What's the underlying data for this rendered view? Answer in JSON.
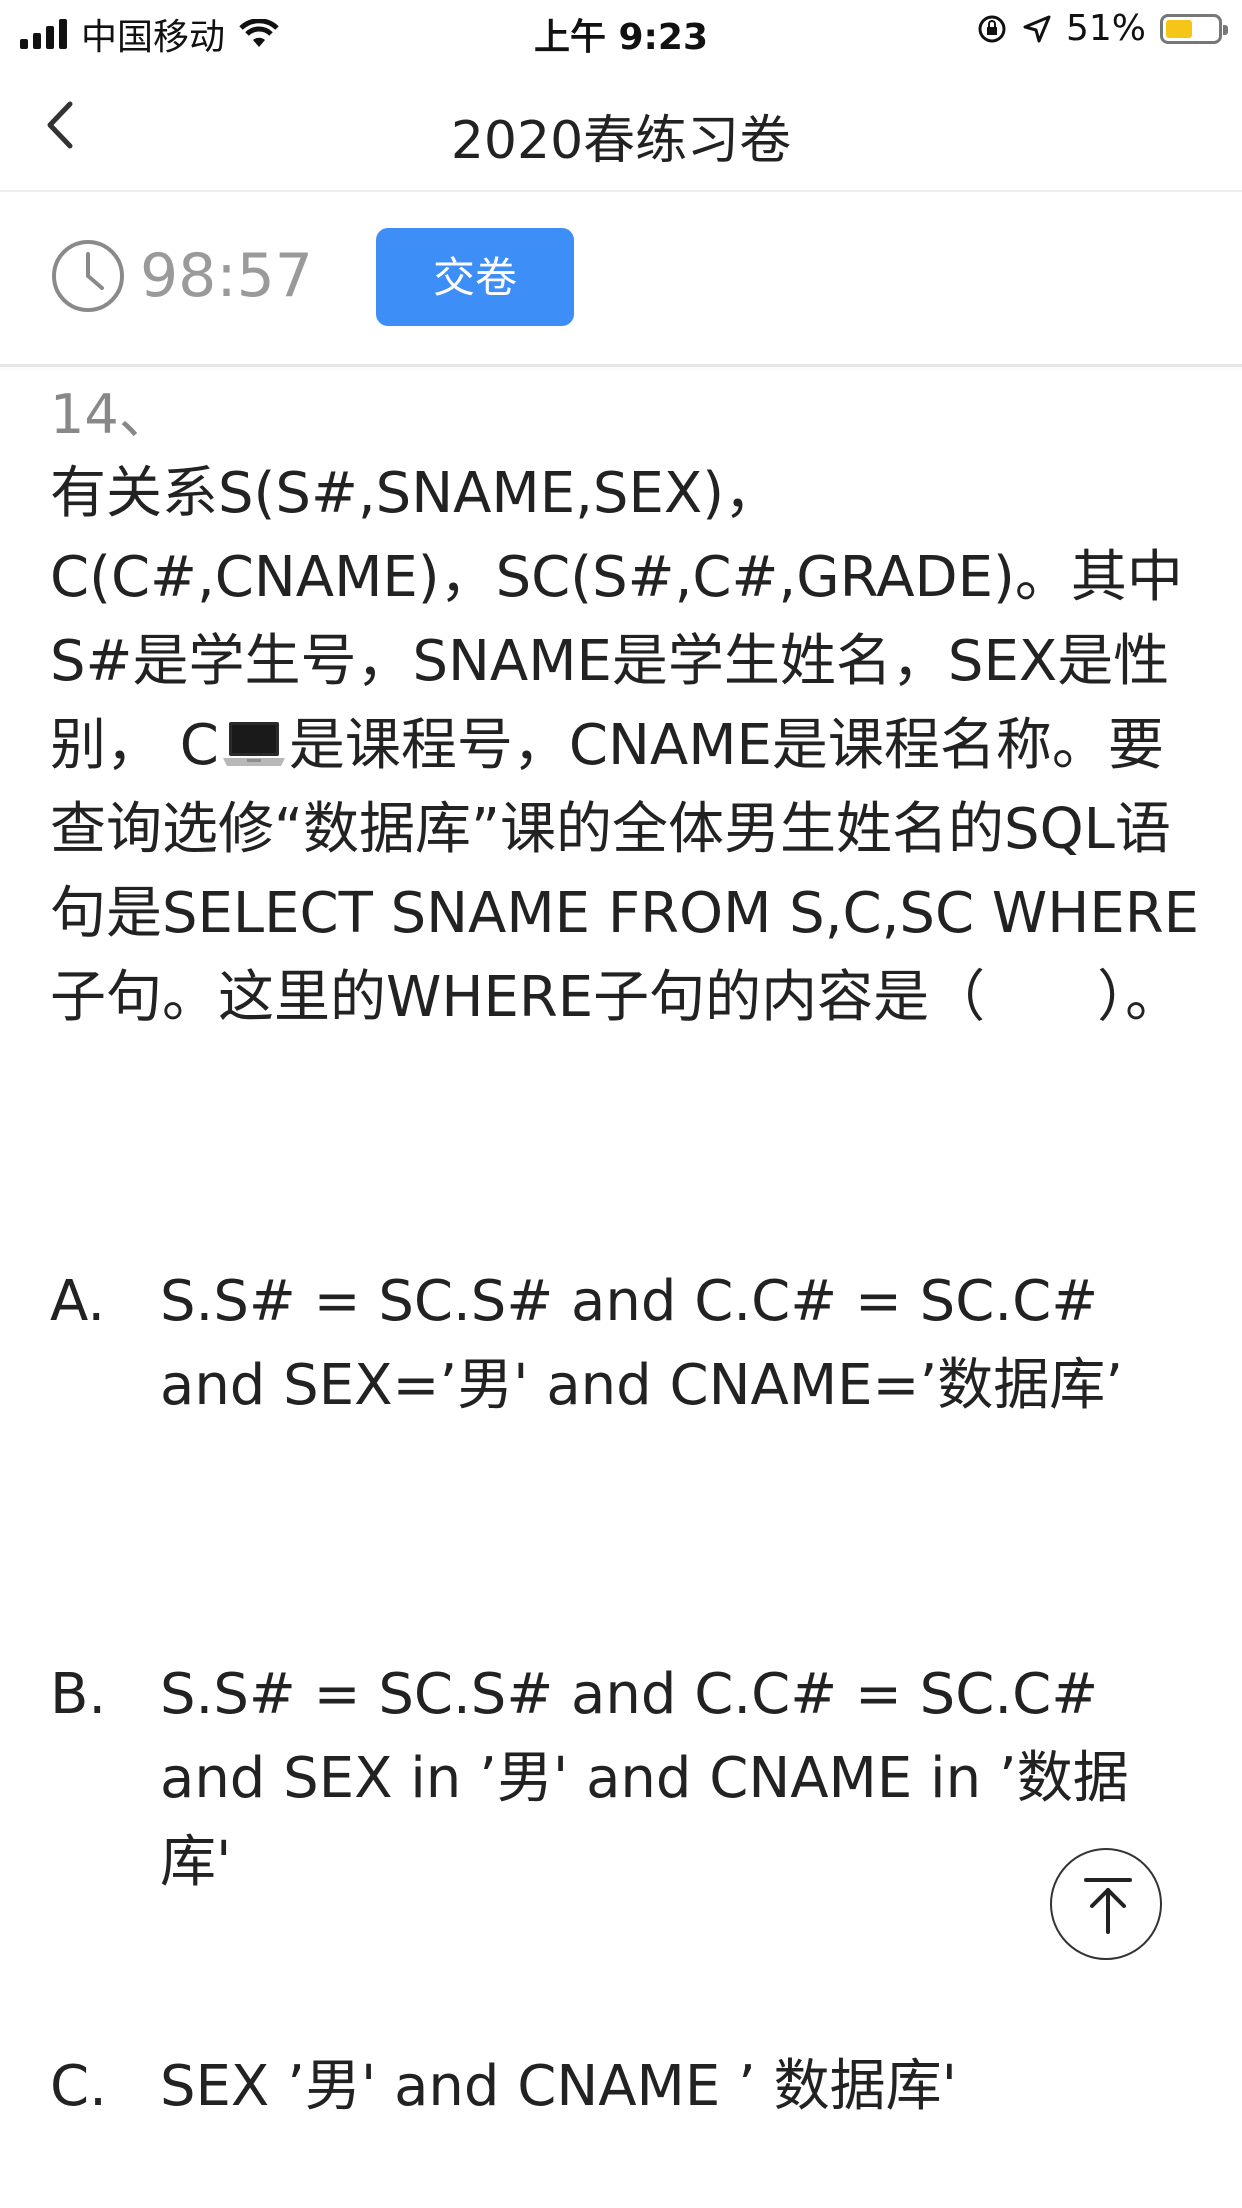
{
  "status_bar": {
    "carrier": "中国移动",
    "time": "上午 9:23",
    "battery_percent": "51%",
    "battery_level": 0.51,
    "icons": [
      "signal-icon",
      "wifi-icon",
      "orientation-lock-icon",
      "location-icon",
      "battery-icon"
    ]
  },
  "nav": {
    "title": "2020春练习卷",
    "back_icon": "chevron-left-icon"
  },
  "toolbar": {
    "timer": "98:57",
    "timer_icon": "clock-icon",
    "submit_label": "交卷",
    "accent_color": "#3e8ef7"
  },
  "question": {
    "number": "14、",
    "text_part1": "有关系S(S#,SNAME,SEX)，C(C#,CNAME)，SC(S#,C#,GRADE)。其中S#是学生号，SNAME是学生姓名，SEX是性别， C",
    "inline_icon": "laptop-icon",
    "text_part2": "是课程号，CNAME是课程名称。要查询选修“数据库”课的全体男生姓名的SQL语句是SELECT SNAME FROM S,C,SC WHERE子句。这里的WHERE子句的内容是（　　）。"
  },
  "options": [
    {
      "letter": "A.",
      "text": "S.S# = SC.S# and C.C# = SC.C# and SEX=’男' and CNAME=’数据库’"
    },
    {
      "letter": "B.",
      "text": "S.S# = SC.S# and C.C# = SC.C# and SEX in ’男' and CNAME in ’数据库'"
    },
    {
      "letter": "C.",
      "text": "SEX ’男' and CNAME ’ 数据库'"
    }
  ],
  "back_to_top_icon": "arrow-up-to-top-icon"
}
